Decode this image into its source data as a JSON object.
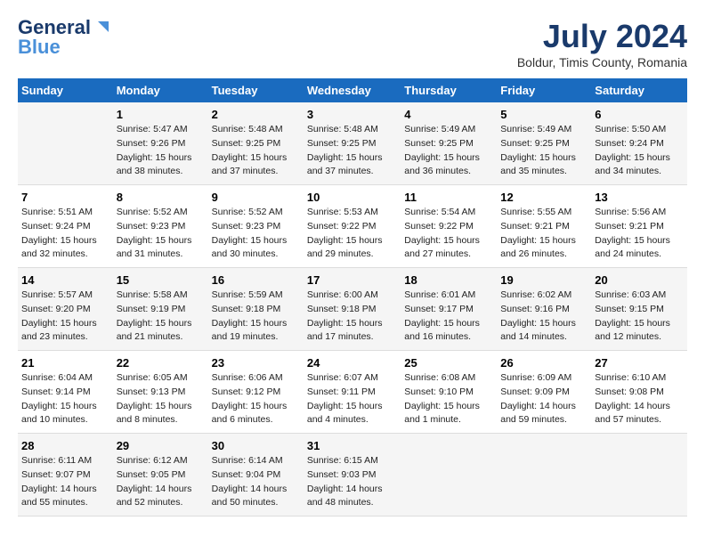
{
  "header": {
    "logo_line1": "General",
    "logo_line2": "Blue",
    "month": "July 2024",
    "location": "Boldur, Timis County, Romania"
  },
  "weekdays": [
    "Sunday",
    "Monday",
    "Tuesday",
    "Wednesday",
    "Thursday",
    "Friday",
    "Saturday"
  ],
  "weeks": [
    [
      {
        "day": "",
        "sunrise": "",
        "sunset": "",
        "daylight": ""
      },
      {
        "day": "1",
        "sunrise": "Sunrise: 5:47 AM",
        "sunset": "Sunset: 9:26 PM",
        "daylight": "Daylight: 15 hours and 38 minutes."
      },
      {
        "day": "2",
        "sunrise": "Sunrise: 5:48 AM",
        "sunset": "Sunset: 9:25 PM",
        "daylight": "Daylight: 15 hours and 37 minutes."
      },
      {
        "day": "3",
        "sunrise": "Sunrise: 5:48 AM",
        "sunset": "Sunset: 9:25 PM",
        "daylight": "Daylight: 15 hours and 37 minutes."
      },
      {
        "day": "4",
        "sunrise": "Sunrise: 5:49 AM",
        "sunset": "Sunset: 9:25 PM",
        "daylight": "Daylight: 15 hours and 36 minutes."
      },
      {
        "day": "5",
        "sunrise": "Sunrise: 5:49 AM",
        "sunset": "Sunset: 9:25 PM",
        "daylight": "Daylight: 15 hours and 35 minutes."
      },
      {
        "day": "6",
        "sunrise": "Sunrise: 5:50 AM",
        "sunset": "Sunset: 9:24 PM",
        "daylight": "Daylight: 15 hours and 34 minutes."
      }
    ],
    [
      {
        "day": "7",
        "sunrise": "Sunrise: 5:51 AM",
        "sunset": "Sunset: 9:24 PM",
        "daylight": "Daylight: 15 hours and 32 minutes."
      },
      {
        "day": "8",
        "sunrise": "Sunrise: 5:52 AM",
        "sunset": "Sunset: 9:23 PM",
        "daylight": "Daylight: 15 hours and 31 minutes."
      },
      {
        "day": "9",
        "sunrise": "Sunrise: 5:52 AM",
        "sunset": "Sunset: 9:23 PM",
        "daylight": "Daylight: 15 hours and 30 minutes."
      },
      {
        "day": "10",
        "sunrise": "Sunrise: 5:53 AM",
        "sunset": "Sunset: 9:22 PM",
        "daylight": "Daylight: 15 hours and 29 minutes."
      },
      {
        "day": "11",
        "sunrise": "Sunrise: 5:54 AM",
        "sunset": "Sunset: 9:22 PM",
        "daylight": "Daylight: 15 hours and 27 minutes."
      },
      {
        "day": "12",
        "sunrise": "Sunrise: 5:55 AM",
        "sunset": "Sunset: 9:21 PM",
        "daylight": "Daylight: 15 hours and 26 minutes."
      },
      {
        "day": "13",
        "sunrise": "Sunrise: 5:56 AM",
        "sunset": "Sunset: 9:21 PM",
        "daylight": "Daylight: 15 hours and 24 minutes."
      }
    ],
    [
      {
        "day": "14",
        "sunrise": "Sunrise: 5:57 AM",
        "sunset": "Sunset: 9:20 PM",
        "daylight": "Daylight: 15 hours and 23 minutes."
      },
      {
        "day": "15",
        "sunrise": "Sunrise: 5:58 AM",
        "sunset": "Sunset: 9:19 PM",
        "daylight": "Daylight: 15 hours and 21 minutes."
      },
      {
        "day": "16",
        "sunrise": "Sunrise: 5:59 AM",
        "sunset": "Sunset: 9:18 PM",
        "daylight": "Daylight: 15 hours and 19 minutes."
      },
      {
        "day": "17",
        "sunrise": "Sunrise: 6:00 AM",
        "sunset": "Sunset: 9:18 PM",
        "daylight": "Daylight: 15 hours and 17 minutes."
      },
      {
        "day": "18",
        "sunrise": "Sunrise: 6:01 AM",
        "sunset": "Sunset: 9:17 PM",
        "daylight": "Daylight: 15 hours and 16 minutes."
      },
      {
        "day": "19",
        "sunrise": "Sunrise: 6:02 AM",
        "sunset": "Sunset: 9:16 PM",
        "daylight": "Daylight: 15 hours and 14 minutes."
      },
      {
        "day": "20",
        "sunrise": "Sunrise: 6:03 AM",
        "sunset": "Sunset: 9:15 PM",
        "daylight": "Daylight: 15 hours and 12 minutes."
      }
    ],
    [
      {
        "day": "21",
        "sunrise": "Sunrise: 6:04 AM",
        "sunset": "Sunset: 9:14 PM",
        "daylight": "Daylight: 15 hours and 10 minutes."
      },
      {
        "day": "22",
        "sunrise": "Sunrise: 6:05 AM",
        "sunset": "Sunset: 9:13 PM",
        "daylight": "Daylight: 15 hours and 8 minutes."
      },
      {
        "day": "23",
        "sunrise": "Sunrise: 6:06 AM",
        "sunset": "Sunset: 9:12 PM",
        "daylight": "Daylight: 15 hours and 6 minutes."
      },
      {
        "day": "24",
        "sunrise": "Sunrise: 6:07 AM",
        "sunset": "Sunset: 9:11 PM",
        "daylight": "Daylight: 15 hours and 4 minutes."
      },
      {
        "day": "25",
        "sunrise": "Sunrise: 6:08 AM",
        "sunset": "Sunset: 9:10 PM",
        "daylight": "Daylight: 15 hours and 1 minute."
      },
      {
        "day": "26",
        "sunrise": "Sunrise: 6:09 AM",
        "sunset": "Sunset: 9:09 PM",
        "daylight": "Daylight: 14 hours and 59 minutes."
      },
      {
        "day": "27",
        "sunrise": "Sunrise: 6:10 AM",
        "sunset": "Sunset: 9:08 PM",
        "daylight": "Daylight: 14 hours and 57 minutes."
      }
    ],
    [
      {
        "day": "28",
        "sunrise": "Sunrise: 6:11 AM",
        "sunset": "Sunset: 9:07 PM",
        "daylight": "Daylight: 14 hours and 55 minutes."
      },
      {
        "day": "29",
        "sunrise": "Sunrise: 6:12 AM",
        "sunset": "Sunset: 9:05 PM",
        "daylight": "Daylight: 14 hours and 52 minutes."
      },
      {
        "day": "30",
        "sunrise": "Sunrise: 6:14 AM",
        "sunset": "Sunset: 9:04 PM",
        "daylight": "Daylight: 14 hours and 50 minutes."
      },
      {
        "day": "31",
        "sunrise": "Sunrise: 6:15 AM",
        "sunset": "Sunset: 9:03 PM",
        "daylight": "Daylight: 14 hours and 48 minutes."
      },
      {
        "day": "",
        "sunrise": "",
        "sunset": "",
        "daylight": ""
      },
      {
        "day": "",
        "sunrise": "",
        "sunset": "",
        "daylight": ""
      },
      {
        "day": "",
        "sunrise": "",
        "sunset": "",
        "daylight": ""
      }
    ]
  ]
}
